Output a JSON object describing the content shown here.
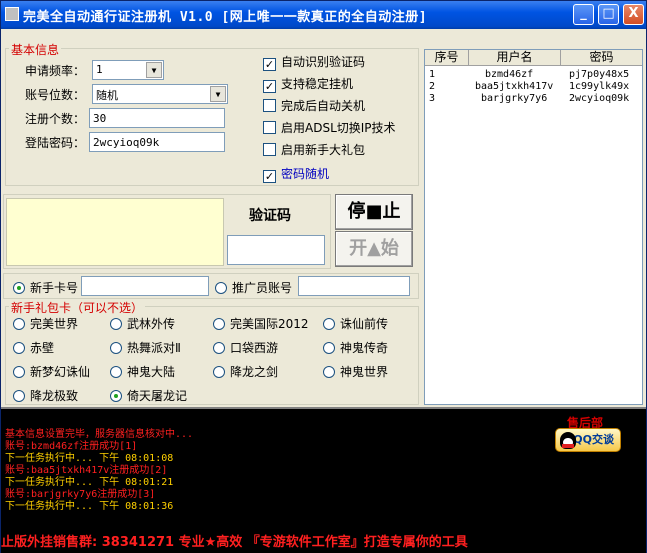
{
  "window": {
    "title": "完美全自动通行证注册机 V1.0 [网上唯一一款真正的全自动注册]"
  },
  "titlebar": {
    "minimize": "_",
    "maximize": "□",
    "close": "X"
  },
  "basic_info": {
    "legend": "基本信息",
    "frequency_label": "申请频率：",
    "frequency_value": "1",
    "digits_label": "账号位数：",
    "digits_value": "随机",
    "count_label": "注册个数：",
    "count_value": "30",
    "password_label": "登陆密码：",
    "password_value": "2wcyioq09k"
  },
  "options": [
    {
      "label": "自动识别验证码",
      "checked": true
    },
    {
      "label": "支持稳定挂机",
      "checked": true
    },
    {
      "label": "完成后自动关机",
      "checked": false
    },
    {
      "label": "启用ADSL切换IP技术",
      "checked": false
    },
    {
      "label": "启用新手大礼包",
      "checked": false
    },
    {
      "label": "密码随机",
      "checked": true
    }
  ],
  "captcha": {
    "label": "验证码"
  },
  "buttons": {
    "stop": "停■止",
    "start": "开▲始"
  },
  "card": {
    "newbie_label": "新手卡号",
    "promoter_label": "推广员账号",
    "gift_legend": "新手礼包卡（可以不选）",
    "gifts": [
      "完美世界",
      "武林外传",
      "完美国际2012",
      "诛仙前传",
      "赤壁",
      "热舞派对Ⅱ",
      "口袋西游",
      "神鬼传奇",
      "新梦幻诛仙",
      "神鬼大陆",
      "降龙之剑",
      "神鬼世界",
      "降龙极致",
      "倚天屠龙记"
    ],
    "selected_gift": "倚天屠龙记"
  },
  "table": {
    "headers": [
      "序号",
      "用户名",
      "密码"
    ],
    "rows": [
      [
        "1",
        "bzmd46zf",
        "pj7p0y48x5"
      ],
      [
        "2",
        "baa5jtxkh417v",
        "1c99ylk49x"
      ],
      [
        "3",
        "barjgrky7y6",
        "2wcyioq09k"
      ]
    ]
  },
  "log": {
    "lines": [
      {
        "text": "基本信息设置完毕，服务器信息核对中...",
        "color": "#ff2020"
      },
      {
        "text": "账号:bzmd46zf注册成功[1]",
        "color": "#ff2020"
      },
      {
        "text": "下一任务执行中...      下午 08:01:08",
        "color": "#ffd000"
      },
      {
        "text": "账号:baa5jtxkh417v注册成功[2]",
        "color": "#ff2020"
      },
      {
        "text": "下一任务执行中...      下午 08:01:21",
        "color": "#ffd000"
      },
      {
        "text": "账号:barjgrky7y6注册成功[3]",
        "color": "#ff2020"
      },
      {
        "text": "下一任务执行中...      下午 08:01:36",
        "color": "#ffd000"
      }
    ]
  },
  "aftersale": {
    "label": "售后部",
    "qq_label": "QQ交谈"
  },
  "status_bar": {
    "text": "止版外挂销售群: 38341271 专业★高效          『专游软件工作室』打造专属你的工具"
  }
}
